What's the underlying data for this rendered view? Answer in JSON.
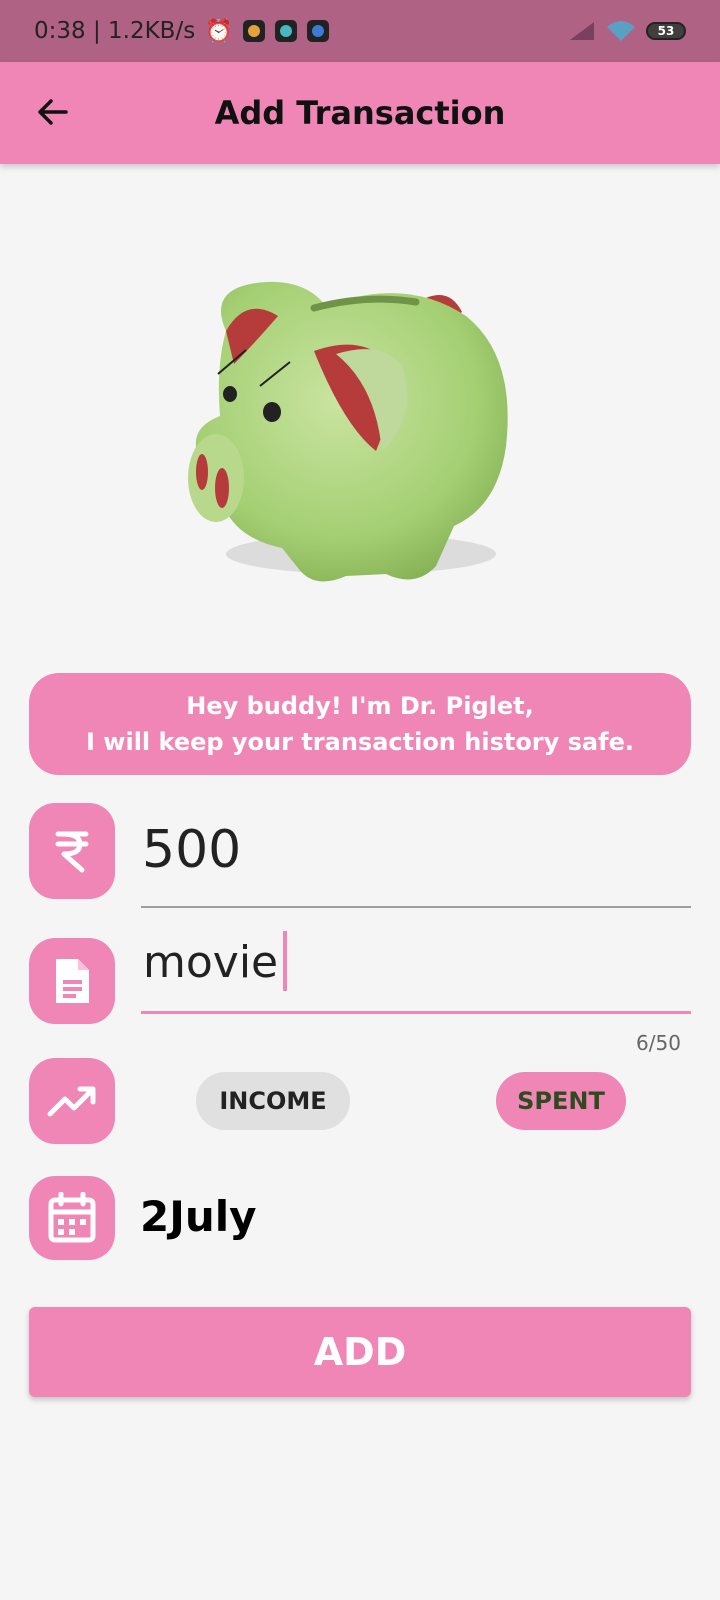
{
  "status_bar": {
    "time_speed": "0:38 | 1.2KB/s",
    "battery": "53"
  },
  "app_bar": {
    "title": "Add Transaction",
    "back_icon": "arrow-back-icon"
  },
  "banner": {
    "line1": "Hey buddy! I'm Dr. Piglet,",
    "line2": "I will keep your transaction history safe."
  },
  "form": {
    "amount": {
      "icon": "rupee-icon",
      "value": "500"
    },
    "note": {
      "icon": "document-icon",
      "value": "movie",
      "counter": "6/50"
    },
    "type": {
      "icon": "trending-up-icon",
      "options": [
        "INCOME",
        "SPENT"
      ],
      "selected": "SPENT"
    },
    "date": {
      "icon": "calendar-icon",
      "value": "2July"
    }
  },
  "actions": {
    "add_label": "ADD"
  },
  "colors": {
    "accent": "#f086b6",
    "status_bar": "#b06284",
    "background": "#f5f5f5",
    "chip_unselected": "#e0e0e0"
  }
}
